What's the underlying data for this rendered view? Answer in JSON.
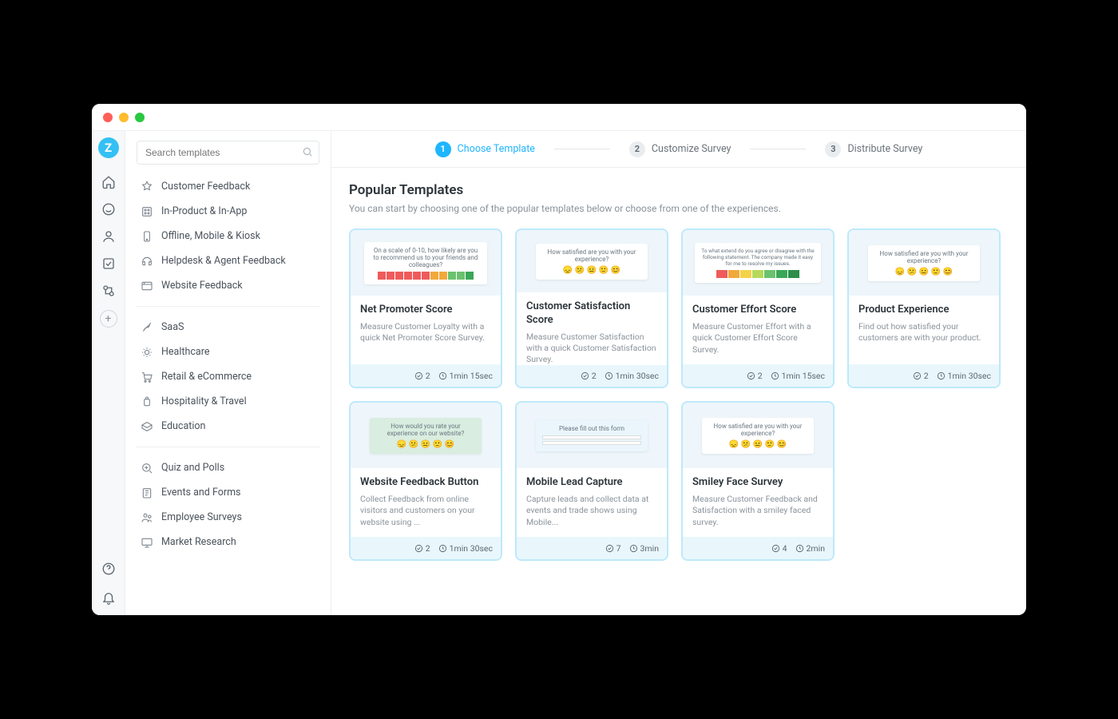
{
  "search": {
    "placeholder": "Search templates"
  },
  "stepper": {
    "steps": [
      {
        "n": "1",
        "label": "Choose Template"
      },
      {
        "n": "2",
        "label": "Customize Survey"
      },
      {
        "n": "3",
        "label": "Distribute Survey"
      }
    ]
  },
  "header": {
    "title": "Popular Templates",
    "subtitle": "You can start by choosing one of the popular templates below or choose from one of the experiences."
  },
  "sidebar": {
    "group1": [
      {
        "label": "Customer Feedback"
      },
      {
        "label": "In-Product & In-App"
      },
      {
        "label": "Offline, Mobile & Kiosk"
      },
      {
        "label": "Helpdesk & Agent Feedback"
      },
      {
        "label": "Website Feedback"
      }
    ],
    "group2": [
      {
        "label": "SaaS"
      },
      {
        "label": "Healthcare"
      },
      {
        "label": "Retail & eCommerce"
      },
      {
        "label": "Hospitality & Travel"
      },
      {
        "label": "Education"
      }
    ],
    "group3": [
      {
        "label": "Quiz and Polls"
      },
      {
        "label": "Events and Forms"
      },
      {
        "label": "Employee Surveys"
      },
      {
        "label": "Market Research"
      }
    ]
  },
  "cards": [
    {
      "title": "Net Promoter Score",
      "desc": "Measure Customer Loyalty with a quick Net Promoter Score Survey.",
      "q": "2",
      "t": "1min 15sec",
      "thumbText": "On a scale of 0-10, how likely are you to recommend us to your friends and colleagues?",
      "thumbKind": "nps"
    },
    {
      "title": "Customer Satisfaction Score",
      "desc": "Measure Customer Satisfaction with a quick Customer Satisfaction Survey.",
      "q": "2",
      "t": "1min 30sec",
      "thumbText": "How satisfied are you with your experience?",
      "thumbKind": "emoji"
    },
    {
      "title": "Customer Effort Score",
      "desc": "Measure Customer Effort with a quick Customer Effort Score Survey.",
      "q": "2",
      "t": "1min 15sec",
      "thumbText": "To what extend do you agree or disagree with the following statement. The company made it easy for me to resolve my issues.",
      "thumbKind": "ces"
    },
    {
      "title": "Product Experience",
      "desc": "Find out how satisfied your customers are with your product.",
      "q": "2",
      "t": "1min 30sec",
      "thumbText": "How satisfied are you with your experience?",
      "thumbKind": "emoji"
    },
    {
      "title": "Website Feedback Button",
      "desc": "Collect Feedback from online visitors and customers on your website using ...",
      "q": "2",
      "t": "1min 30sec",
      "thumbText": "How would you rate your experience on our website?",
      "thumbKind": "emoji-green"
    },
    {
      "title": "Mobile Lead Capture",
      "desc": "Capture leads and collect data at events and trade shows using Mobile...",
      "q": "7",
      "t": "3min",
      "thumbText": "Please fill out this form",
      "thumbKind": "form"
    },
    {
      "title": "Smiley Face Survey",
      "desc": "Measure Customer Feedback and Satisfaction with a smiley faced survey.",
      "q": "4",
      "t": "2min",
      "thumbText": "How satisfied are you with your experience?",
      "thumbKind": "emoji-big"
    }
  ]
}
